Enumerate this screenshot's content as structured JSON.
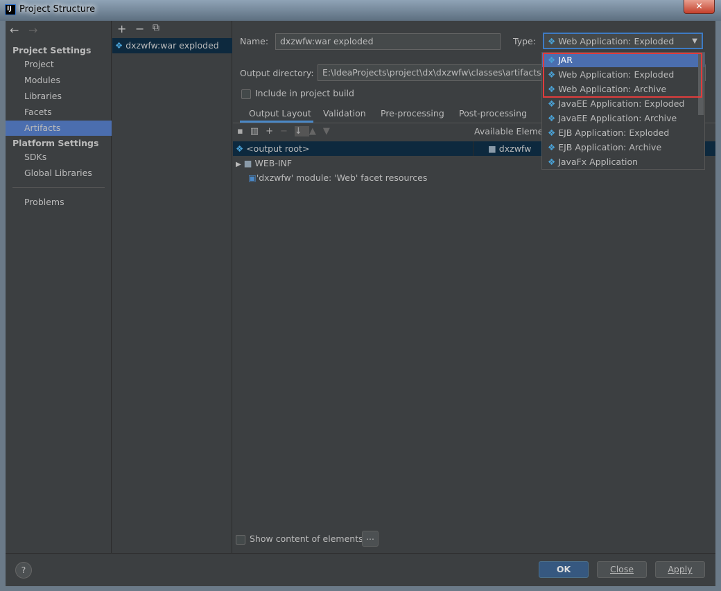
{
  "window": {
    "title": "Project Structure",
    "close": "✕"
  },
  "nav": {
    "back": "←",
    "forward": "→",
    "project_settings": "Project Settings",
    "items1": [
      "Project",
      "Modules",
      "Libraries",
      "Facets",
      "Artifacts"
    ],
    "platform_settings": "Platform Settings",
    "items2": [
      "SDKs",
      "Global Libraries"
    ],
    "problems": "Problems",
    "selected": "Artifacts"
  },
  "artifacts": {
    "toolbar": [
      "+",
      "−",
      "⧉"
    ],
    "items": [
      "dxzwfw:war exploded"
    ]
  },
  "form": {
    "name_label": "Name:",
    "name_value": "dxzwfw:war exploded",
    "type_label": "Type:",
    "type_value": "Web Application: Exploded",
    "output_label": "Output directory:",
    "output_value": "E:\\IdeaProjects\\project\\dx\\dxzwfw\\classes\\artifacts\\dx",
    "include_label": "Include in project build",
    "include_checked": false
  },
  "tabs": [
    "Output Layout",
    "Validation",
    "Pre-processing",
    "Post-processing"
  ],
  "active_tab": "Output Layout",
  "layout": {
    "available_label": "Available Elemen",
    "tree": [
      "<output root>",
      "WEB-INF",
      "'dxzwfw' module: 'Web' facet resources"
    ],
    "available_items": [
      "dxzwfw"
    ],
    "show_content_label": "Show content of elements",
    "more": "..."
  },
  "type_options": [
    "JAR",
    "Web Application: Exploded",
    "Web Application: Archive",
    "JavaEE Application: Exploded",
    "JavaEE Application: Archive",
    "EJB Application: Exploded",
    "EJB Application: Archive",
    "JavaFx Application"
  ],
  "type_highlighted": "JAR",
  "footer": {
    "help": "?",
    "ok": "OK",
    "close": "Close",
    "apply": "Apply"
  },
  "colors": {
    "bg": "#3c3f41",
    "selection": "#4b6eaf",
    "highlight_box": "#e03c3c"
  }
}
